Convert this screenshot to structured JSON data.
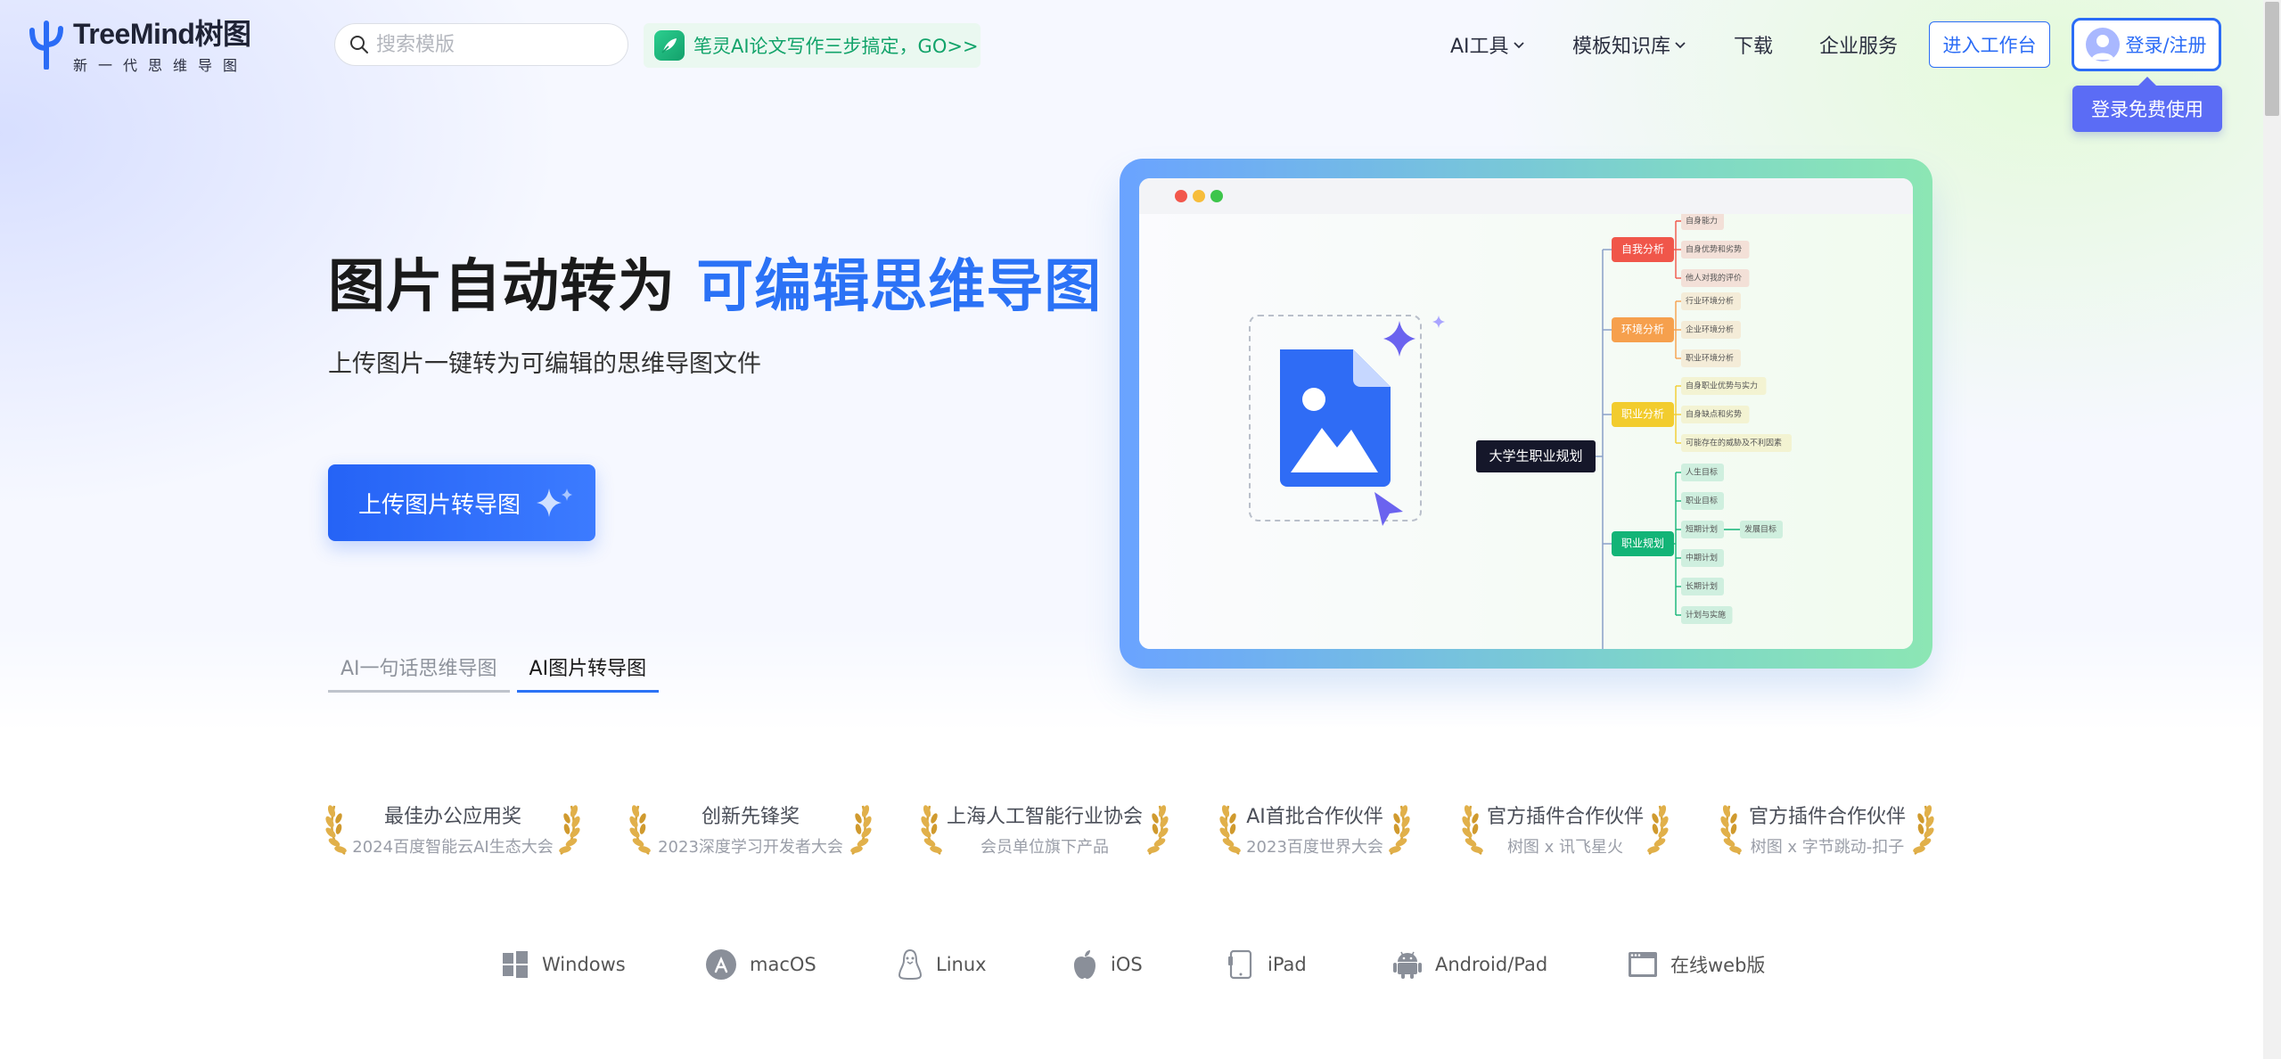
{
  "brand": {
    "name": "TreeMind树图",
    "slogan": "新一代思维导图",
    "color": "#2b6cf6"
  },
  "search": {
    "placeholder": "搜索模版"
  },
  "promo": {
    "text": "笔灵AI论文写作三步搞定，GO>>"
  },
  "nav": {
    "items": [
      {
        "label": "AI工具",
        "dropdown": true
      },
      {
        "label": "模板知识库",
        "dropdown": true
      },
      {
        "label": "下载",
        "dropdown": false
      },
      {
        "label": "企业服务",
        "dropdown": false
      }
    ],
    "workbench": "进入工作台",
    "login": "登录/注册",
    "login_tooltip": "登录免费使用"
  },
  "hero": {
    "title_main": "图片自动转为",
    "title_accent": "可编辑思维导图",
    "subtitle": "上传图片一键转为可编辑的思维导图文件",
    "cta": "上传图片转导图",
    "tabs": [
      {
        "label": "AI一句话思维导图",
        "active": false
      },
      {
        "label": "AI图片转导图",
        "active": true
      }
    ]
  },
  "mindmap": {
    "root": "大学生职业规划",
    "branches": [
      {
        "label": "自我分析",
        "color": "#f0564a",
        "children": [
          "自身能力",
          "自身优势和劣势",
          "他人对我的评价"
        ]
      },
      {
        "label": "环境分析",
        "color": "#f6a04d",
        "children": [
          "行业环境分析",
          "企业环境分析",
          "职业环境分析"
        ]
      },
      {
        "label": "职业分析",
        "color": "#f2cc2e",
        "children": [
          "自身职业优势与实力",
          "自身缺点和劣势",
          "可能存在的威胁及不利因素"
        ]
      },
      {
        "label": "职业规划",
        "color": "#13b477",
        "children": [
          "人生目标",
          "职业目标",
          "短期计划",
          "中期计划",
          "长期计划",
          "计划与实施"
        ]
      }
    ],
    "extra": "发展目标"
  },
  "awards": [
    {
      "title": "最佳办公应用奖",
      "sub": "2024百度智能云AI生态大会"
    },
    {
      "title": "创新先锋奖",
      "sub": "2023深度学习开发者大会"
    },
    {
      "title": "上海人工智能行业协会",
      "sub": "会员单位旗下产品"
    },
    {
      "title": "AI首批合作伙伴",
      "sub": "2023百度世界大会"
    },
    {
      "title": "官方插件合作伙伴",
      "sub": "树图 x 讯飞星火"
    },
    {
      "title": "官方插件合作伙伴",
      "sub": "树图 x 字节跳动-扣子"
    }
  ],
  "platforms": [
    {
      "label": "Windows",
      "icon": "windows-icon"
    },
    {
      "label": "macOS",
      "icon": "appstore-icon"
    },
    {
      "label": "Linux",
      "icon": "linux-icon"
    },
    {
      "label": "iOS",
      "icon": "apple-icon"
    },
    {
      "label": "iPad",
      "icon": "ipad-icon"
    },
    {
      "label": "Android/Pad",
      "icon": "android-icon"
    },
    {
      "label": "在线web版",
      "icon": "web-icon"
    }
  ]
}
